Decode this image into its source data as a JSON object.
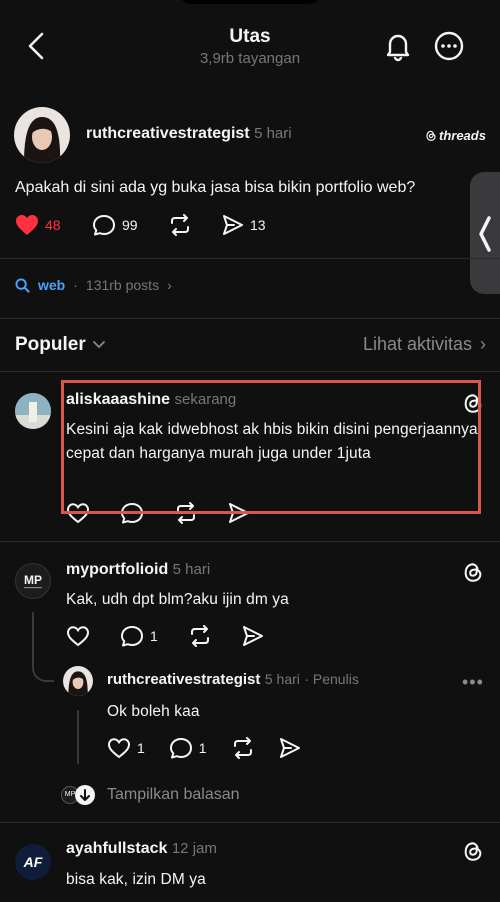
{
  "header": {
    "title": "Utas",
    "subtitle": "3,9rb tayangan"
  },
  "post": {
    "username": "ruthcreativestrategist",
    "time": "5 hari",
    "brand": "threads",
    "text": "Apakah di sini ada yg buka jasa bisa bikin portfolio web?",
    "likes": "48",
    "comments": "99",
    "shares": "13",
    "liked": true,
    "like_color": "#ff3040"
  },
  "topic": {
    "name": "web",
    "count": "131rb posts"
  },
  "sort": {
    "label": "Populer",
    "activity": "Lihat aktivitas"
  },
  "replies": [
    {
      "username": "aliskaaashine",
      "time": "sekarang",
      "text": "Kesini aja kak idwebhost ak hbis bikin disini pengerjaannya cepat dan harganya murah juga under 1juta",
      "highlight_color": "#d9584b"
    },
    {
      "username": "myportfolioid",
      "time": "5 hari",
      "text": "Kak, udh dpt blm?aku ijin dm ya",
      "comments": "1",
      "nested": {
        "username": "ruthcreativestrategist",
        "time": "5 hari",
        "role": "· Penulis",
        "text": "Ok boleh kaa",
        "likes": "1",
        "comments": "1"
      },
      "show_replies": "Tampilkan balasan"
    },
    {
      "username": "ayahfullstack",
      "time": "12 jam",
      "text": "bisa kak, izin DM ya"
    }
  ],
  "colors": {
    "background": "#101010",
    "accent_link": "#4aa3ff"
  }
}
